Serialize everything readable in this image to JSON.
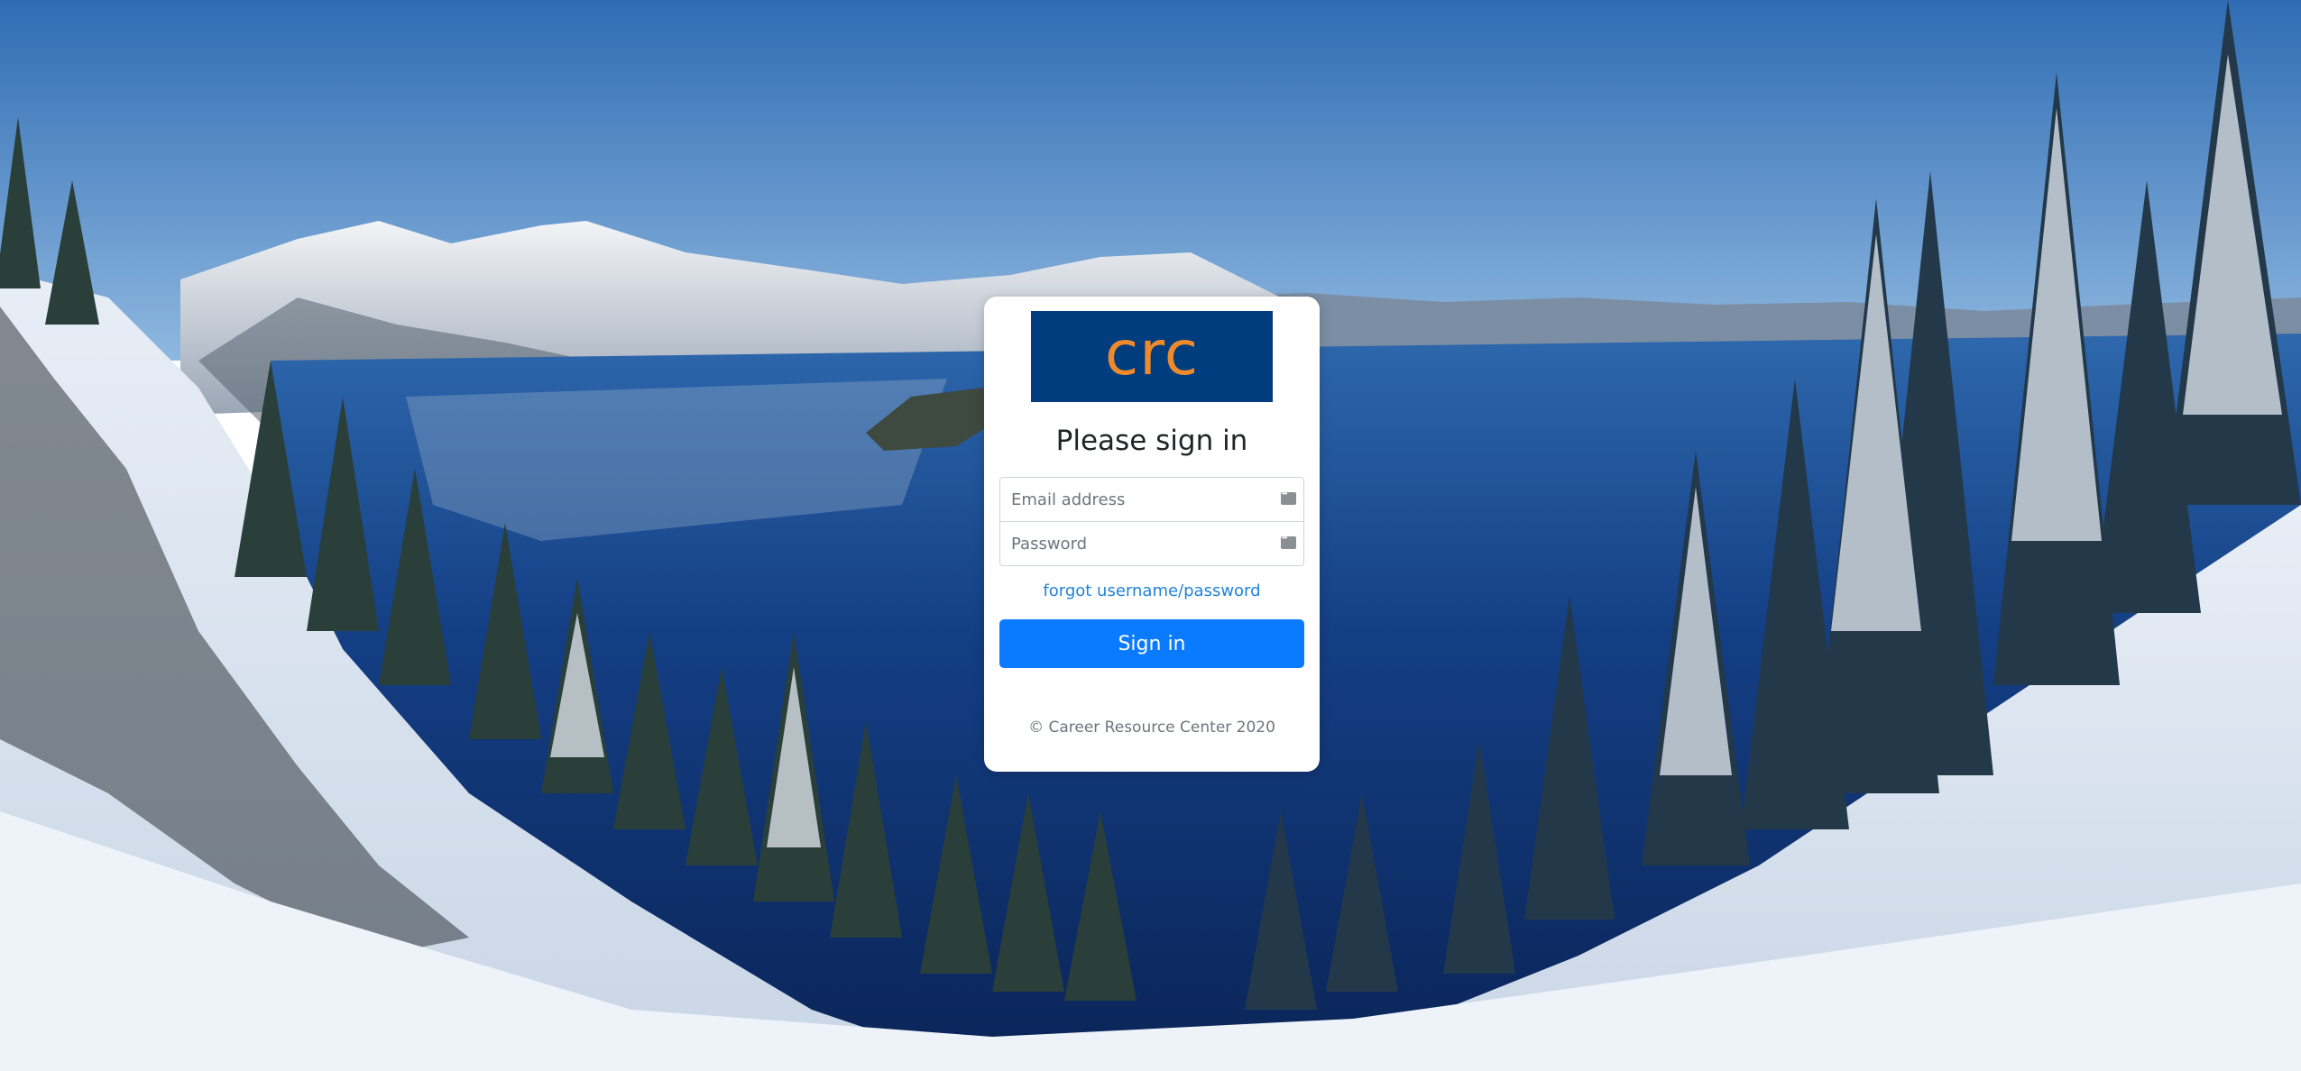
{
  "page": {
    "background_scene": "snowy crater lake with mountains and pine trees"
  },
  "card": {
    "logo_text": "crc",
    "heading": "Please sign in",
    "email": {
      "placeholder": "Email address",
      "value": ""
    },
    "password": {
      "placeholder": "Password",
      "value": ""
    },
    "forgot_link": "forgot username/password",
    "signin_label": "Sign in",
    "footer": "© Career Resource Center 2020"
  },
  "colors": {
    "logo_bg": "#003d7e",
    "logo_text": "#ee8a2c",
    "primary_button": "#0a7bff",
    "link": "#2083d8"
  },
  "icons": {
    "field_icon": "password-manager-icon"
  }
}
